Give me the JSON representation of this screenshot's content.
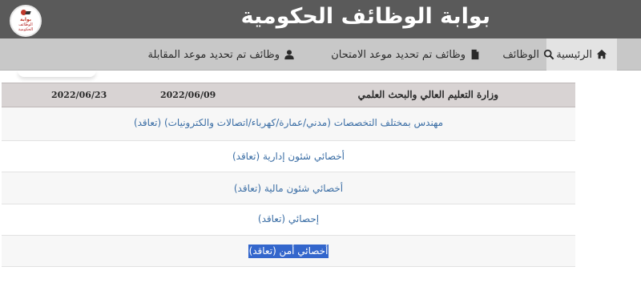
{
  "header": {
    "title": "بوابة الوظائف الحكومية",
    "logo_text_line1": "بوابة",
    "logo_text_line2": "الوظائف",
    "logo_text_line3": "الحكومية"
  },
  "nav": {
    "items": [
      {
        "label": "الرئيسية",
        "icon": "home-icon"
      },
      {
        "label": "الوظائف",
        "icon": "search-icon"
      },
      {
        "label": "وظائف تم تحديد موعد الامتحان",
        "icon": "file-icon"
      },
      {
        "label": "وظائف تم تحديد موعد المقابلة",
        "icon": "user-icon"
      }
    ]
  },
  "table": {
    "header": {
      "ministry": "وزارة التعليم العالي والبحث العلمي",
      "date1": "2022/06/09",
      "date2": "2022/06/23"
    },
    "rows": [
      {
        "line1": "مهندس بمختلف التخصصات (مدني/عمارة/كهرباء/اتصالات والكترونيات) (تعاقد)"
      },
      {
        "line1": "أخصائي شئون إدارية (تعاقد)"
      },
      {
        "line1": "أخصائي شئون مالية (تعاقد)"
      },
      {
        "line1": "إحصائي (تعاقد)"
      },
      {
        "line1": "أخصائي أمن (تعاقد)",
        "selected": true
      }
    ]
  },
  "colors": {
    "header_bg": "#5a5a5a",
    "nav_bg": "#c8c8c8",
    "link": "#3b6ea5",
    "selection": "#3366cc"
  }
}
